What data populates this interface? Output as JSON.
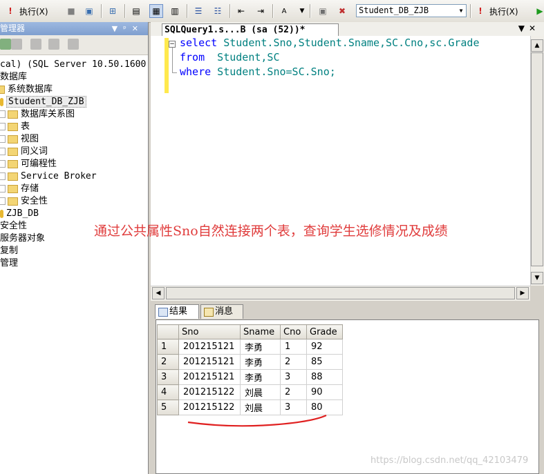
{
  "toolbar": {
    "execute_label_1": "执行(X)",
    "database": "Student_DB_ZJB",
    "execute_label_2": "执行(X)"
  },
  "explorer": {
    "title": "管理器",
    "items": [
      {
        "label": "cal) (SQL Server 10.50.1600"
      },
      {
        "label": "数据库"
      },
      {
        "label": "系统数据库"
      },
      {
        "label": "Student_DB_ZJB"
      },
      {
        "label": "数据库关系图"
      },
      {
        "label": "表"
      },
      {
        "label": "视图"
      },
      {
        "label": "同义词"
      },
      {
        "label": "可编程性"
      },
      {
        "label": "Service Broker"
      },
      {
        "label": "存储"
      },
      {
        "label": "安全性"
      },
      {
        "label": "ZJB_DB"
      },
      {
        "label": "安全性"
      },
      {
        "label": "服务器对象"
      },
      {
        "label": "复制"
      },
      {
        "label": "管理"
      }
    ]
  },
  "query": {
    "tab_title": "SQLQuery1.s...B (sa (52))*",
    "line1_kw": "select",
    "line1_rest": " Student.Sno,Student.Sname,SC.Cno,sc.Grade",
    "line2_kw": "from",
    "line2_rest": "  Student,SC",
    "line3_kw": "where",
    "line3_rest": " Student.Sno=SC.Sno;"
  },
  "annotation": "通过公共属性Sno自然连接两个表，查询学生选修情况及成绩",
  "results": {
    "tab_results": "结果",
    "tab_messages": "消息",
    "columns": [
      "Sno",
      "Sname",
      "Cno",
      "Grade"
    ],
    "rows": [
      {
        "n": "1",
        "sno": "201215121",
        "sname": "李勇",
        "cno": "1",
        "grade": "92"
      },
      {
        "n": "2",
        "sno": "201215121",
        "sname": "李勇",
        "cno": "2",
        "grade": "85"
      },
      {
        "n": "3",
        "sno": "201215121",
        "sname": "李勇",
        "cno": "3",
        "grade": "88"
      },
      {
        "n": "4",
        "sno": "201215122",
        "sname": "刘晨",
        "cno": "2",
        "grade": "90"
      },
      {
        "n": "5",
        "sno": "201215122",
        "sname": "刘晨",
        "cno": "3",
        "grade": "80"
      }
    ]
  },
  "watermark": "https://blog.csdn.net/qq_42103479",
  "colors": {
    "keyword": "#0000ff",
    "identifier": "#008080",
    "annotation": "#e03c3c"
  }
}
